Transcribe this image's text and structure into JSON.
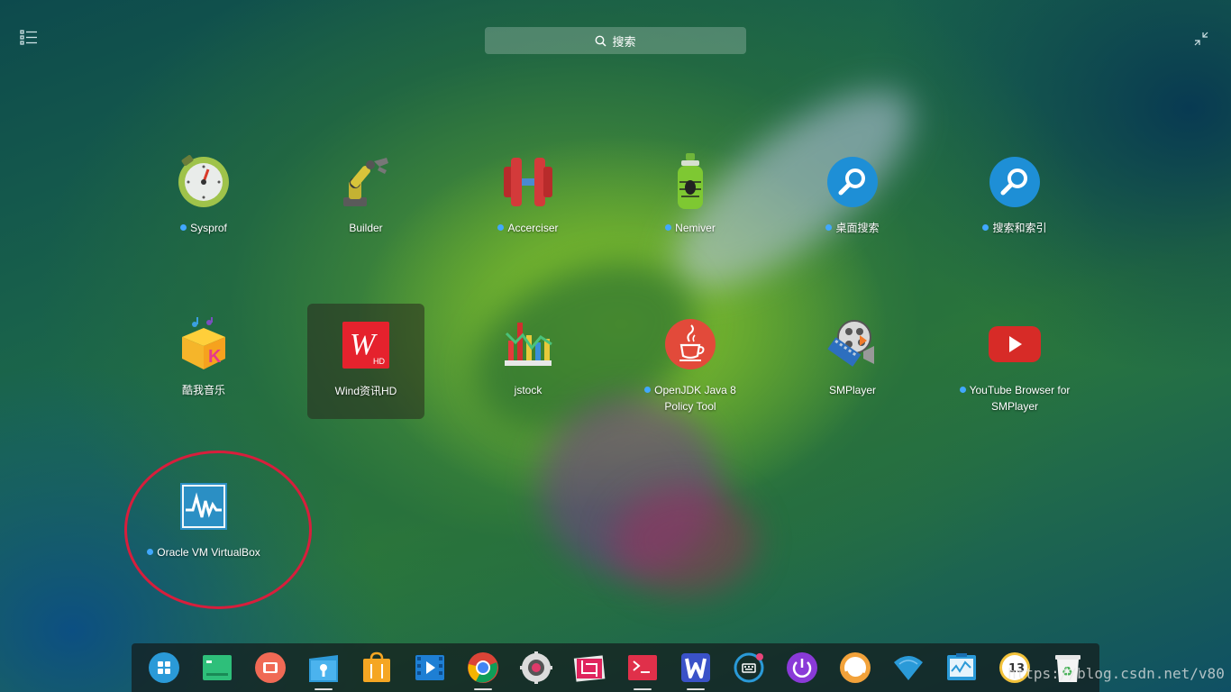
{
  "search": {
    "placeholder": "搜索"
  },
  "apps": [
    {
      "label": "Sysprof",
      "new": true
    },
    {
      "label": "Builder",
      "new": false
    },
    {
      "label": "Accerciser",
      "new": true
    },
    {
      "label": "Nemiver",
      "new": true
    },
    {
      "label": "桌面搜索",
      "new": true
    },
    {
      "label": "搜索和索引",
      "new": true
    },
    {
      "label": "酷我音乐",
      "new": false
    },
    {
      "label": "Wind资讯HD",
      "new": false,
      "selected": true,
      "icon_text": "W",
      "icon_badge": "HD"
    },
    {
      "label": "jstock",
      "new": false
    },
    {
      "label": "OpenJDK Java 8 Policy Tool",
      "new": true
    },
    {
      "label": "SMPlayer",
      "new": false
    },
    {
      "label": "YouTube Browser for SMPlayer",
      "new": true
    },
    {
      "label": "Oracle VM VirtualBox",
      "new": true
    }
  ],
  "dock": [
    "launcher-icon",
    "deepin-terminal-green-icon",
    "screen-recorder-icon",
    "file-manager-icon",
    "app-store-icon",
    "video-player-icon",
    "chrome-icon",
    "control-center-icon",
    "screenshot-icon",
    "terminal-icon",
    "wps-writer-icon",
    "keyboard-icon",
    "power-icon",
    "network-monitor-icon",
    "wifi-icon",
    "system-monitor-icon",
    "clock-icon",
    "trash-icon"
  ],
  "dock_clock": "13",
  "watermark": "https://blog.csdn.net/v80",
  "colors": {
    "new_dot": "#41a8ff",
    "highlight_circle": "#d81e3c"
  }
}
